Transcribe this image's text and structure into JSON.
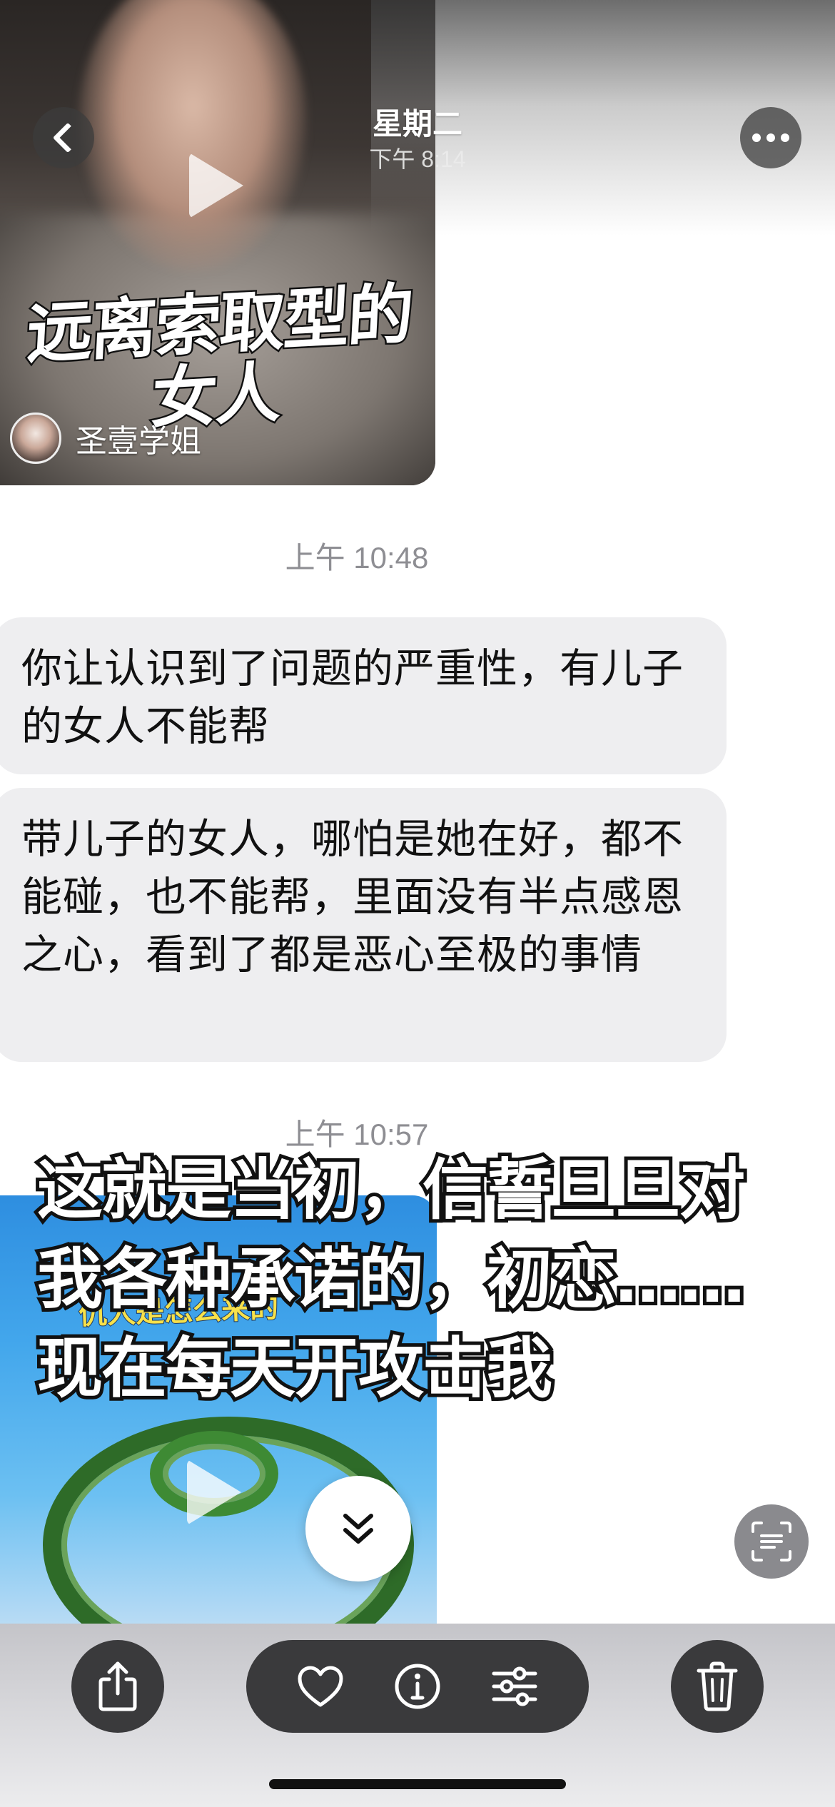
{
  "header": {
    "title": "星期二",
    "subtitle": "下午 8:14"
  },
  "video_top": {
    "overlay_title": "远离索取型的女人",
    "author_name": "圣壹学姐"
  },
  "messages": [
    {
      "timestamp": "上午 10:48"
    },
    {
      "text": "你让认识到了问题的严重性，有儿子的女人不能帮"
    },
    {
      "text": "带儿子的女人，哪怕是她在好，都不能碰，也不能帮，里面没有半点感恩之心，看到了都是恶心至极的事情"
    },
    {
      "timestamp": "上午 10:57"
    }
  ],
  "video_bottom": {
    "inner_text": "仇人是怎么来的"
  },
  "overlay_caption": "这就是当初，信誓旦旦对我各种承诺的，初恋……现在每天开攻击我",
  "toolbar": {
    "icons": [
      "share-icon",
      "heart-icon",
      "info-icon",
      "adjust-icon",
      "trash-icon"
    ]
  },
  "colors": {
    "bubble": "#eeeef0",
    "timestamp": "#8e8e93",
    "toolbar_button": "#3a3a3c"
  }
}
